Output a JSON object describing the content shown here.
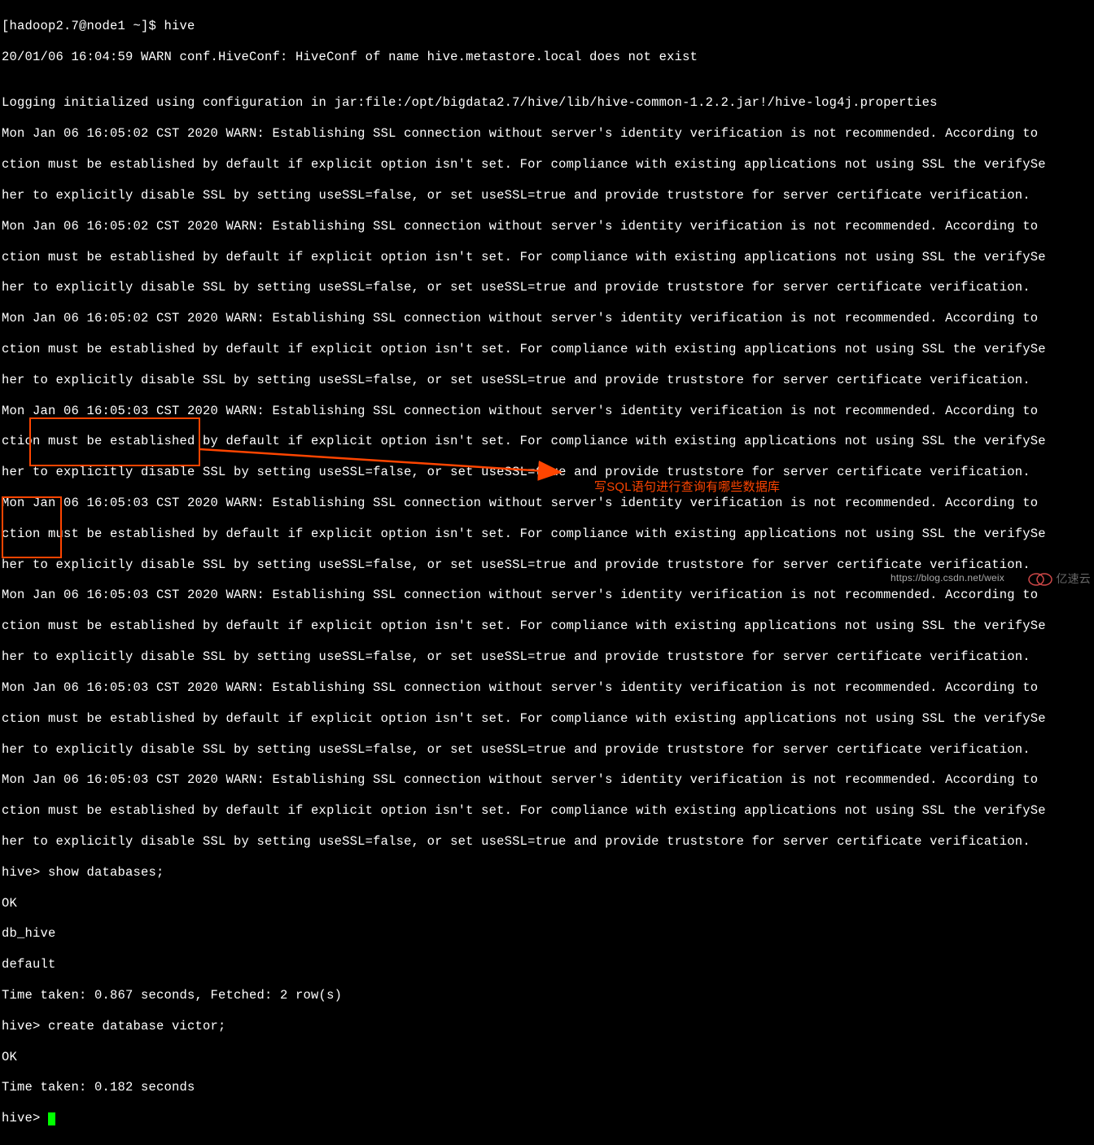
{
  "terminal": {
    "prompt_line": "[hadoop2.7@node1 ~]$ hive",
    "warn_line": "20/01/06 16:04:59 WARN conf.HiveConf: HiveConf of name hive.metastore.local does not exist",
    "blank": "",
    "logging_line": "Logging initialized using configuration in jar:file:/opt/bigdata2.7/hive/lib/hive-common-1.2.2.jar!/hive-log4j.properties",
    "ssl_warn_02_a": "Mon Jan 06 16:05:02 CST 2020 WARN: Establishing SSL connection without server's identity verification is not recommended. According to ",
    "ssl_warn_b": "ction must be established by default if explicit option isn't set. For compliance with existing applications not using SSL the verifySe",
    "ssl_warn_c": "her to explicitly disable SSL by setting useSSL=false, or set useSSL=true and provide truststore for server certificate verification.",
    "ssl_warn_03_a": "Mon Jan 06 16:05:03 CST 2020 WARN: Establishing SSL connection without server's identity verification is not recommended. According to ",
    "hive_show_db": "hive> show databases;",
    "ok_1": "OK",
    "db_hive": "db_hive",
    "default_db": "default",
    "time_1": "Time taken: 0.867 seconds, Fetched: 2 row(s)",
    "hive_create": "hive> create database victor;",
    "ok_2": "OK",
    "time_2": "Time taken: 0.182 seconds",
    "hive_prompt": "hive> "
  },
  "annotation": {
    "text": "写SQL语句进行查询有哪些数据库"
  },
  "watermark": {
    "csdn": "https://blog.csdn.net/weix",
    "yisu": "亿速云"
  }
}
